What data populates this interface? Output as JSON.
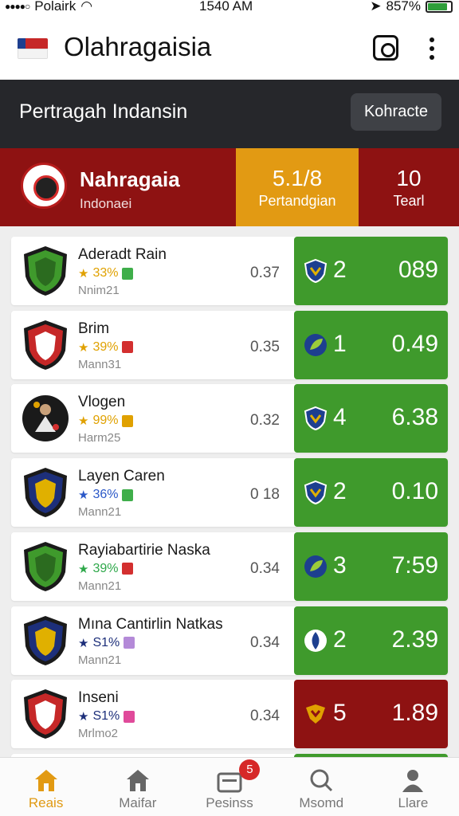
{
  "status_bar": {
    "carrier": "Polairk",
    "time": "1540 AM",
    "battery": "857%",
    "battery_level": 0.85
  },
  "app_bar": {
    "title": "Olahragaisia",
    "flag_icon": "flag-icon",
    "camera_icon": "camera-icon",
    "more_icon": "more-vertical-icon"
  },
  "header": {
    "title": "Pertragah Indansin",
    "button_label": "Kohracte"
  },
  "summary": {
    "team_name": "Nahragaia",
    "team_sub": "Indonaei",
    "matches_value": "5.1/8",
    "matches_label": "Pertandgian",
    "teams_value": "10",
    "teams_label": "Tearl"
  },
  "colors": {
    "accent": "#e29a13",
    "primary_dark": "#8e1212",
    "win_green": "#3f9a2c",
    "loss_red": "#8e1212",
    "header_dark": "#26272b"
  },
  "rows": [
    {
      "name": "Aderadt Rain",
      "percent": "33%",
      "star_color": "#e0a100",
      "tag_color": "#3fae4a",
      "meta": "Nnim21",
      "ratio": "0.37",
      "score": "2",
      "points": "089",
      "score_bg": "#3f9a2c",
      "badge": "green-shield",
      "icon": "shield-icon"
    },
    {
      "name": "Brim",
      "percent": "39%",
      "star_color": "#e0a100",
      "tag_color": "#d32f2f",
      "meta": "Mann31",
      "ratio": "0.35",
      "score": "1",
      "points": "0.49",
      "score_bg": "#3f9a2c",
      "badge": "red-shield",
      "icon": "leaf-icon"
    },
    {
      "name": "Vlogen",
      "percent": "99%",
      "star_color": "#e0a100",
      "tag_color": "#e0a100",
      "meta": "Harm25",
      "ratio": "0.32",
      "score": "4",
      "points": "6.38",
      "score_bg": "#3f9a2c",
      "badge": "player-photo",
      "icon": "shield-icon"
    },
    {
      "name": "Layen Caren",
      "percent": "36%",
      "star_color": "#2b58c8",
      "tag_color": "#3fae4a",
      "meta": "Mann21",
      "ratio": "0 18",
      "score": "2",
      "points": "0.10",
      "score_bg": "#3f9a2c",
      "badge": "blue-shield",
      "icon": "shield-icon"
    },
    {
      "name": "Rayiabartirie Naska",
      "percent": "39%",
      "star_color": "#2ea84a",
      "tag_color": "#d32f2f",
      "meta": "Mann21",
      "ratio": "0.34",
      "score": "3",
      "points": "7:59",
      "score_bg": "#3f9a2c",
      "badge": "green-shield",
      "icon": "leaf-icon"
    },
    {
      "name": "Mına Cantirlin Natkas",
      "percent": "S1%",
      "star_color": "#1d2f7a",
      "tag_color": "#b48ad8",
      "meta": "Mann21",
      "ratio": "0.34",
      "score": "2",
      "points": "2.39",
      "score_bg": "#3f9a2c",
      "badge": "blue-shield",
      "icon": "drop-icon"
    },
    {
      "name": "Inseni",
      "percent": "S1%",
      "star_color": "#1d2f7a",
      "tag_color": "#e04a9a",
      "meta": "Mrlmo2",
      "ratio": "0.34",
      "score": "5",
      "points": "1.89",
      "score_bg": "#8e1212",
      "badge": "red-shield",
      "icon": "crest-icon"
    }
  ],
  "nav": [
    {
      "label": "Reais",
      "icon": "home-icon",
      "active": true
    },
    {
      "label": "Maifar",
      "icon": "house-icon",
      "active": false
    },
    {
      "label": "Pesinss",
      "icon": "wallet-icon",
      "active": false,
      "badge": "5"
    },
    {
      "label": "Msomd",
      "icon": "search-icon",
      "active": false
    },
    {
      "label": "Llare",
      "icon": "user-icon",
      "active": false
    }
  ]
}
